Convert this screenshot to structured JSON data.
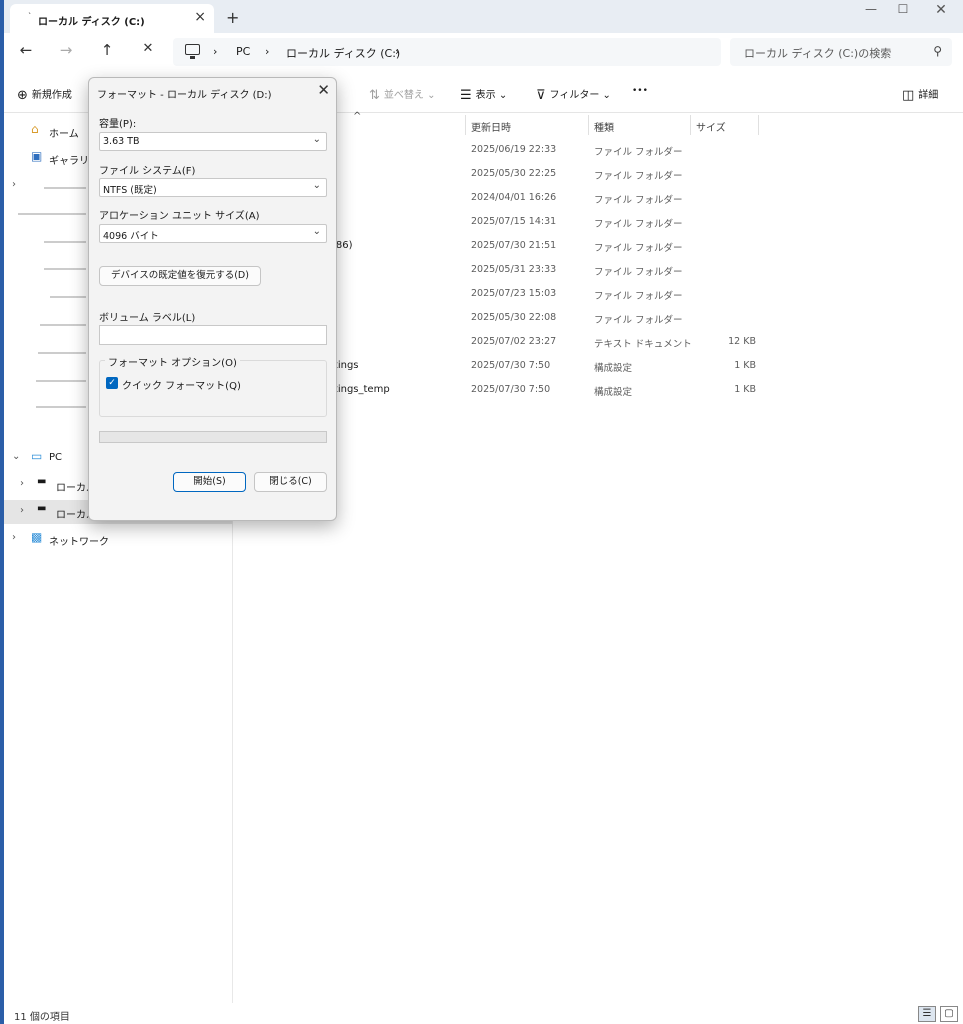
{
  "tab": {
    "label": "ローカル ディスク (C:)"
  },
  "address": {
    "crumbs": [
      "PC",
      "ローカル ディスク (C:)"
    ],
    "search_placeholder": "ローカル ディスク (C:)の検索"
  },
  "commandbar": {
    "new": "新規作成",
    "sort": "並べ替え",
    "view": "表示",
    "filter": "フィルター",
    "more": "•••",
    "details": "詳細"
  },
  "sidebar": {
    "home": "ホーム",
    "gallery": "ギャラリー",
    "pc": "PC",
    "local1": "ローカル",
    "local2": "ローカル",
    "network": "ネットワーク"
  },
  "columns": {
    "modified": "更新日時",
    "type": "種類",
    "size": "サイズ"
  },
  "files": [
    {
      "name": "",
      "modified": "2025/06/19 22:33",
      "type": "ファイル フォルダー",
      "size": ""
    },
    {
      "name": "",
      "modified": "2025/05/30 22:25",
      "type": "ファイル フォルダー",
      "size": ""
    },
    {
      "name": "",
      "modified": "2024/04/01 16:26",
      "type": "ファイル フォルダー",
      "size": ""
    },
    {
      "name": "",
      "modified": "2025/07/15 14:31",
      "type": "ファイル フォルダー",
      "size": ""
    },
    {
      "name": "x86)",
      "modified": "2025/07/30 21:51",
      "type": "ファイル フォルダー",
      "size": ""
    },
    {
      "name": "",
      "modified": "2025/05/31 23:33",
      "type": "ファイル フォルダー",
      "size": ""
    },
    {
      "name": "",
      "modified": "2025/07/23 15:03",
      "type": "ファイル フォルダー",
      "size": ""
    },
    {
      "name": "",
      "modified": "2025/05/30 22:08",
      "type": "ファイル フォルダー",
      "size": ""
    },
    {
      "name": "",
      "modified": "2025/07/02 23:27",
      "type": "テキスト ドキュメント",
      "size": "12 KB"
    },
    {
      "name": "ttings",
      "modified": "2025/07/30 7:50",
      "type": "構成設定",
      "size": "1 KB"
    },
    {
      "name": "ttings_temp",
      "modified": "2025/07/30 7:50",
      "type": "構成設定",
      "size": "1 KB"
    }
  ],
  "status": {
    "count": "11 個の項目"
  },
  "dialog": {
    "title": "フォーマット - ローカル ディスク (D:)",
    "capacity_label": "容量(P):",
    "capacity_value": "3.63 TB",
    "fs_label": "ファイル システム(F)",
    "fs_value": "NTFS (既定)",
    "alloc_label": "アロケーション ユニット サイズ(A)",
    "alloc_value": "4096 バイト",
    "restore_button": "デバイスの既定値を復元する(D)",
    "volume_label": "ボリューム ラベル(L)",
    "volume_value": "",
    "options_legend": "フォーマット オプション(O)",
    "quick_format": "クイック フォーマット(Q)",
    "quick_format_checked": true,
    "start_button": "開始(S)",
    "close_button": "閉じる(C)"
  }
}
